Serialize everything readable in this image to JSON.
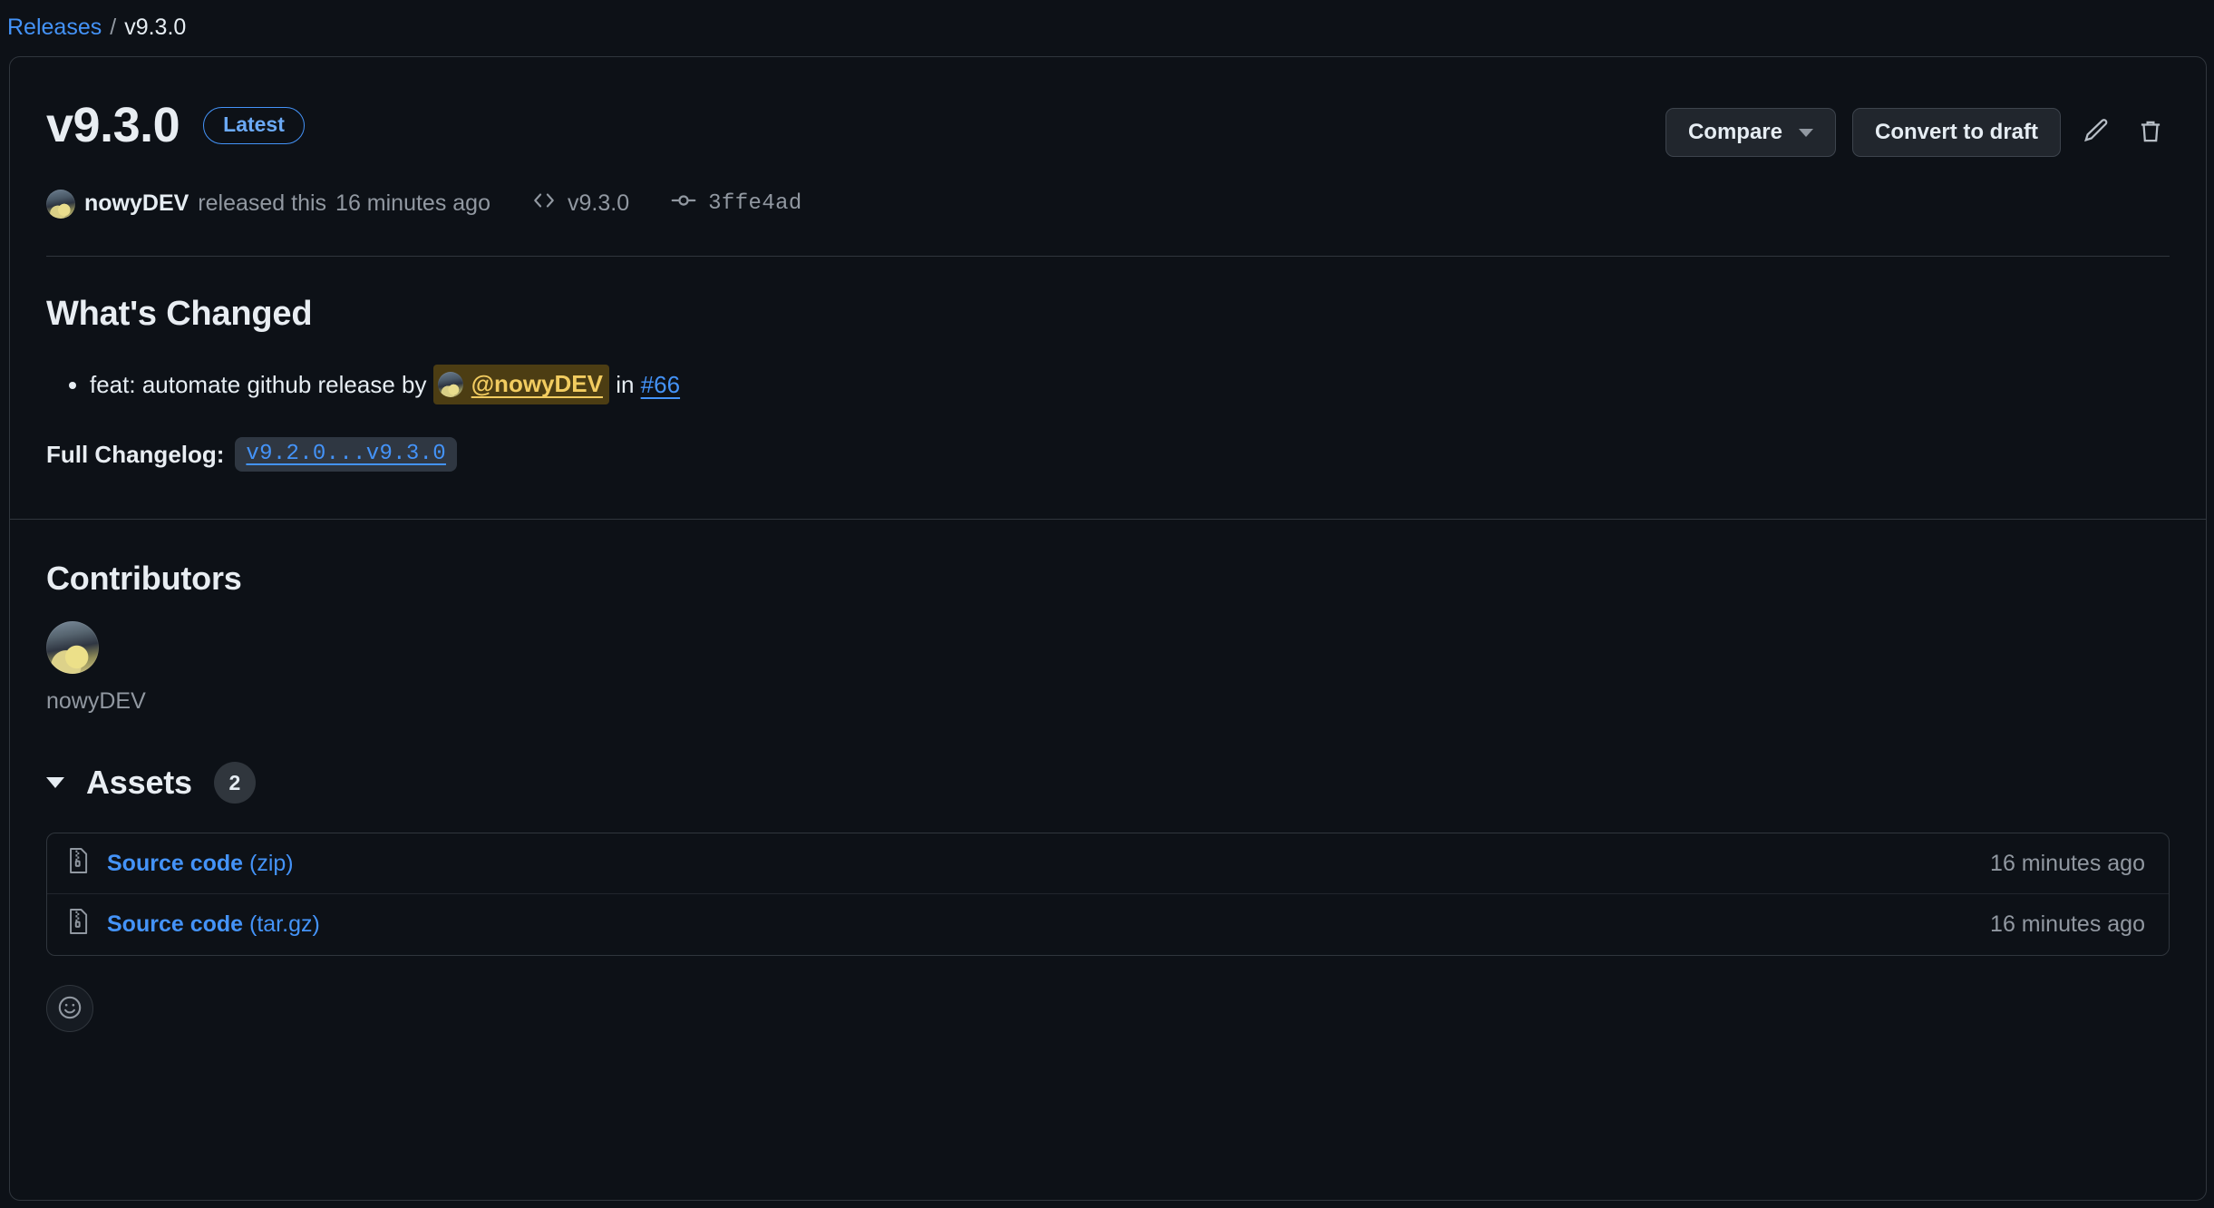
{
  "breadcrumb": {
    "parent": "Releases",
    "separator": "/",
    "current": "v9.3.0"
  },
  "release": {
    "title": "v9.3.0",
    "latest_badge": "Latest",
    "author": "nowyDEV",
    "released_text": "released this",
    "released_time": "16 minutes ago",
    "tag": "v9.3.0",
    "commit": "3ffe4ad"
  },
  "actions": {
    "compare_label": "Compare",
    "convert_label": "Convert to draft",
    "edit_title": "Edit release",
    "delete_title": "Delete release"
  },
  "body": {
    "section_title": "What's Changed",
    "changes": [
      {
        "text_before": "feat: automate github release by ",
        "mention": "@nowyDEV",
        "text_middle": " in ",
        "pr": "#66"
      }
    ],
    "changelog_label": "Full Changelog:",
    "changelog_link": "v9.2.0...v9.3.0"
  },
  "contributors": {
    "title": "Contributors",
    "people": [
      {
        "name": "nowyDEV"
      }
    ]
  },
  "assets": {
    "title": "Assets",
    "count": "2",
    "rows": [
      {
        "name": "Source code",
        "format": " (zip)",
        "date": "16 minutes ago"
      },
      {
        "name": "Source code",
        "format": " (tar.gz)",
        "date": "16 minutes ago"
      }
    ]
  },
  "reactions": {
    "add_label": "Add reaction"
  },
  "colors": {
    "accent_link": "#4493f8",
    "background": "#0d1117",
    "border": "#30363d",
    "mention_bg": "#4c3d13",
    "mention_text": "#f2cc60"
  }
}
